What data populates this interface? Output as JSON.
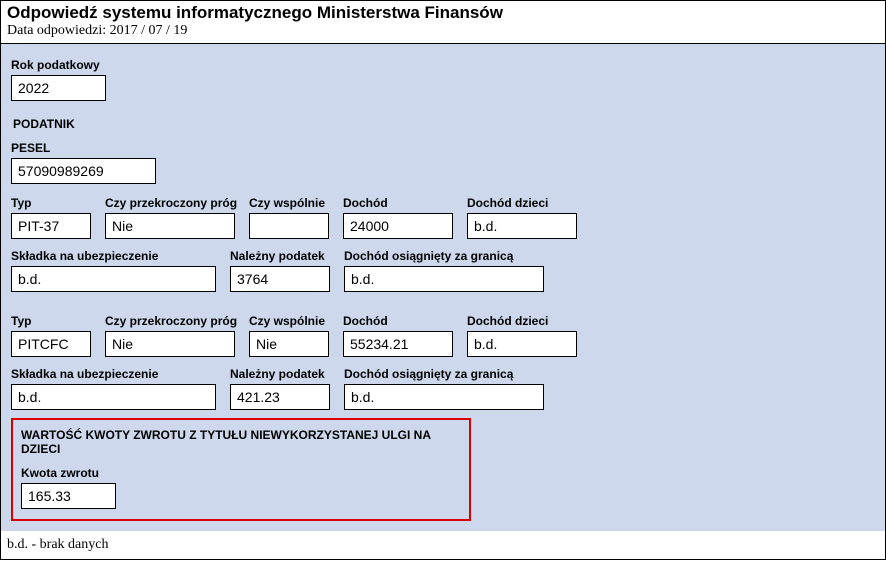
{
  "header": {
    "title": "Odpowiedź systemu informatycznego Ministerstwa Finansów",
    "date_label": "Data odpowiedzi:",
    "date_value": "2017 / 07 / 19"
  },
  "rok_podatkowy": {
    "label": "Rok podatkowy",
    "value": "2022"
  },
  "podatnik_heading": "PODATNIK",
  "pesel": {
    "label": "PESEL",
    "value": "57090989269"
  },
  "block1": {
    "typ": {
      "label": "Typ",
      "value": "PIT-37"
    },
    "prog": {
      "label": "Czy przekroczony próg",
      "value": "Nie"
    },
    "wspolnie": {
      "label": "Czy wspólnie",
      "value": ""
    },
    "dochod": {
      "label": "Dochód",
      "value": "24000"
    },
    "dochod_dzieci": {
      "label": "Dochód dzieci",
      "value": "b.d."
    },
    "skladka": {
      "label": "Składka na ubezpieczenie",
      "value": "b.d."
    },
    "podatek": {
      "label": "Należny podatek",
      "value": "3764"
    },
    "zagranica": {
      "label": "Dochód osiągnięty za granicą",
      "value": "b.d."
    }
  },
  "block2": {
    "typ": {
      "label": "Typ",
      "value": "PITCFC"
    },
    "prog": {
      "label": "Czy przekroczony próg",
      "value": "Nie"
    },
    "wspolnie": {
      "label": "Czy wspólnie",
      "value": "Nie"
    },
    "dochod": {
      "label": "Dochód",
      "value": "55234.21"
    },
    "dochod_dzieci": {
      "label": "Dochód dzieci",
      "value": "b.d."
    },
    "skladka": {
      "label": "Składka na ubezpieczenie",
      "value": "b.d."
    },
    "podatek": {
      "label": "Należny podatek",
      "value": "421.23"
    },
    "zagranica": {
      "label": "Dochód osiągnięty za granicą",
      "value": "b.d."
    }
  },
  "zwrot": {
    "heading": "WARTOŚĆ KWOTY ZWROTU Z TYTUŁU NIEWYKORZYSTANEJ ULGI NA DZIECI",
    "kwota_label": "Kwota zwrotu",
    "kwota_value": "165.33"
  },
  "footer": "b.d. - brak danych"
}
